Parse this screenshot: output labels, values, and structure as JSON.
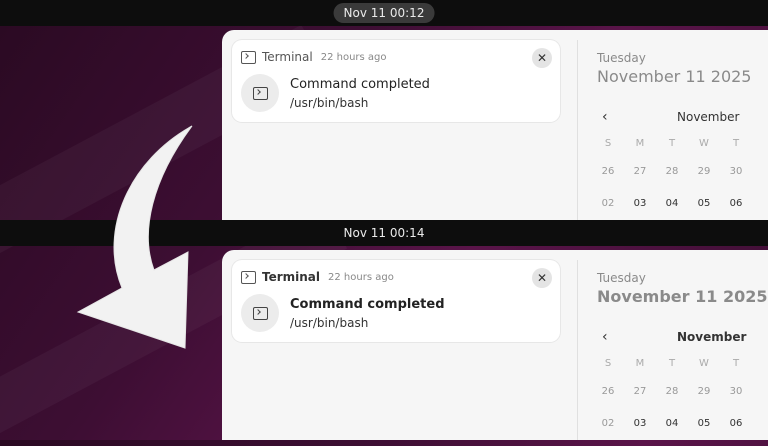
{
  "top": {
    "clock": "Nov 11  00:12",
    "notification": {
      "app": "Terminal",
      "time_ago": "22 hours ago",
      "title": "Command completed",
      "body": "/usr/bin/bash",
      "close": "✕"
    },
    "calendar": {
      "weekday": "Tuesday",
      "date": "November 11 2025",
      "prev": "‹",
      "month": "November",
      "weekdays": [
        "S",
        "M",
        "T",
        "W",
        "T"
      ],
      "row1": [
        "26",
        "27",
        "28",
        "29",
        "30"
      ],
      "row2": [
        "02",
        "03",
        "04",
        "05",
        "06"
      ]
    }
  },
  "bottom": {
    "clock": "Nov 11  00:14",
    "notification": {
      "app": "Terminal",
      "time_ago": "22 hours ago",
      "title": "Command completed",
      "body": "/usr/bin/bash",
      "close": "✕"
    },
    "calendar": {
      "weekday": "Tuesday",
      "date": "November 11 2025",
      "prev": "‹",
      "month": "November",
      "weekdays": [
        "S",
        "M",
        "T",
        "W",
        "T"
      ],
      "row1": [
        "26",
        "27",
        "28",
        "29",
        "30"
      ],
      "row2": [
        "02",
        "03",
        "04",
        "05",
        "06"
      ]
    }
  },
  "icons": {
    "terminal": "terminal-icon",
    "arrow": "curved-arrow-icon"
  },
  "colors": {
    "wallpaper": "#3d0e33",
    "panel": "#f6f6f6",
    "topbar": "#0d0d0d"
  }
}
